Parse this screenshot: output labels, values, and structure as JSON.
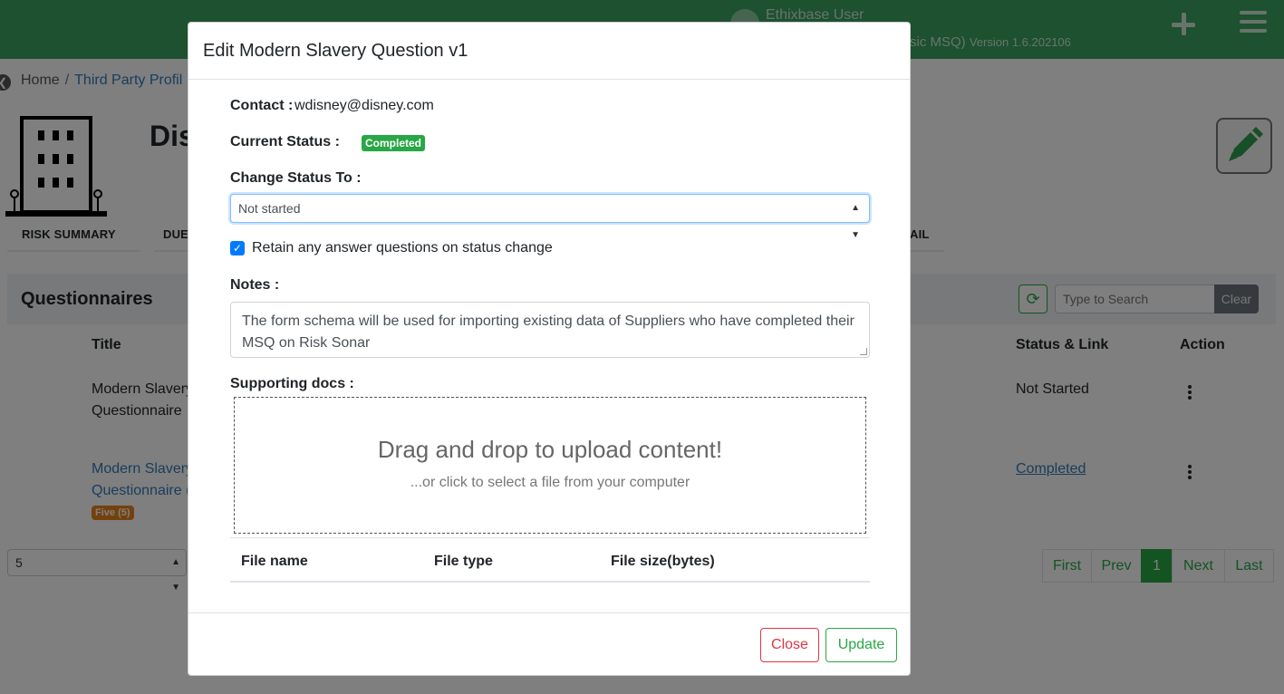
{
  "header": {
    "user_name": "Ethixbase User",
    "app_label": "sic MSQ)",
    "version": "Version 1.6.202106",
    "add_icon": "plus-icon",
    "menu_icon": "hamburger-icon",
    "color": "#3aa35f"
  },
  "breadcrumb": {
    "home": "Home",
    "sep": "/",
    "current": "Third Party Profil"
  },
  "company": {
    "name_partial": "Dis"
  },
  "tabs": [
    "RISK SUMMARY",
    "DUE",
    "AIL"
  ],
  "questionnaires": {
    "title": "Questionnaires",
    "search_placeholder": "Type to Search",
    "clear_label": "Clear",
    "columns": {
      "title": "Title",
      "status": "Status & Link",
      "action": "Action"
    },
    "rows": [
      {
        "title_line1": "Modern Slavery",
        "title_line2": "Questionnaire",
        "status": "Not Started"
      },
      {
        "title_line1": "Modern Slavery",
        "title_line2": "Questionnaire (",
        "badge": "Five (5)",
        "status": "Completed"
      }
    ],
    "page_size": "5",
    "pager": {
      "first": "First",
      "prev": "Prev",
      "current": "1",
      "next": "Next",
      "last": "Last"
    }
  },
  "modal": {
    "title": "Edit Modern Slavery Question v1",
    "contact_label": "Contact :",
    "contact_value": "wdisney@disney.com",
    "current_status_label": "Current Status :",
    "current_status_value": "Completed",
    "change_status_label": "Change Status To :",
    "change_status_value": "Not started",
    "retain_label": "Retain any answer questions on status change",
    "retain_checked": true,
    "notes_label": "Notes :",
    "notes_value": "The form schema will be used for importing existing data of Suppliers who have completed their MSQ on Risk Sonar",
    "supporting_docs_label": "Supporting docs :",
    "dropzone_main": "Drag and drop to upload content!",
    "dropzone_sub": "...or click to select a file from your computer",
    "file_columns": [
      "File name",
      "File type",
      "File size(bytes)"
    ],
    "close_label": "Close",
    "update_label": "Update",
    "colors": {
      "success": "#28a745",
      "danger": "#dc3545",
      "primary": "#007bff"
    }
  }
}
